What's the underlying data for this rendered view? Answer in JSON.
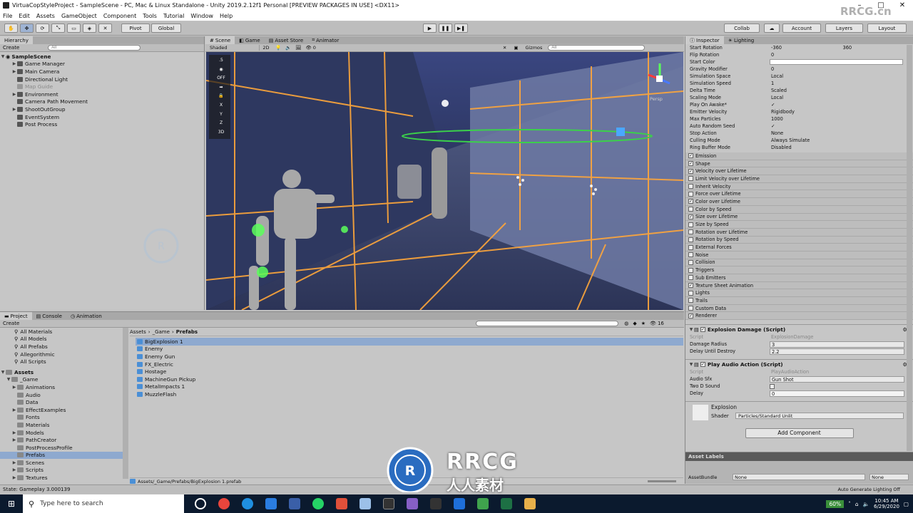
{
  "window": {
    "title": "VirtuaCopStyleProject - SampleScene - PC, Mac & Linux Standalone - Unity 2019.2.12f1 Personal [PREVIEW PACKAGES IN USE] <DX11>"
  },
  "menu": [
    "File",
    "Edit",
    "Assets",
    "GameObject",
    "Component",
    "Tools",
    "Tutorial",
    "Window",
    "Help"
  ],
  "toolbar": {
    "pivot": "Pivot",
    "global": "Global",
    "collab": "Collab",
    "account": "Account",
    "layers": "Layers",
    "layout": "Layout"
  },
  "hierarchy": {
    "tab": "Hierarchy",
    "create": "Create",
    "search_placeholder": "All",
    "scene": "SampleScene",
    "items": [
      "Game Manager",
      "Main Camera",
      "Directional Light",
      "Map Guide",
      "Environment",
      "Camera Path Movement",
      "ShootOutGroup",
      "EventSystem",
      "Post Process"
    ]
  },
  "scene": {
    "tabs": [
      "Scene",
      "Game",
      "Asset Store",
      "Animator"
    ],
    "shading": "Shaded",
    "mode2d": "2D",
    "gizmos": "Gizmos",
    "search_placeholder": "All",
    "persp": "Persp",
    "zero": "0",
    "gizmo_labels": [
      ".5",
      "OFF",
      "X",
      "Y",
      "Z",
      "3D"
    ]
  },
  "project": {
    "tabs": [
      "Project",
      "Console",
      "Animation"
    ],
    "create": "Create",
    "favorites": [
      "All Materials",
      "All Models",
      "All Prefabs",
      "Allegorithmic",
      "All Scripts"
    ],
    "assets_root": "Assets",
    "game_folder": "_Game",
    "folders": [
      "Animations",
      "Audio",
      "Data",
      "EffectExamples",
      "Fonts",
      "Materials",
      "Models",
      "PathCreator",
      "PostProcessProfile",
      "Prefabs",
      "Scenes",
      "Scripts",
      "Textures"
    ],
    "breadcrumb": [
      "Assets",
      "_Game",
      "Prefabs"
    ],
    "files": [
      "BigExplosion 1",
      "Enemy",
      "Enemy Gun",
      "FX_Electric",
      "Hostage",
      "MachineGun Pickup",
      "MetalImpacts 1",
      "MuzzleFlash"
    ],
    "path": "Assets/_Game/Prefabs/BigExplosion 1.prefab",
    "count": "16"
  },
  "inspector": {
    "tabs": [
      "Inspector",
      "Lighting"
    ],
    "props": [
      {
        "label": "Start Rotation",
        "value": "-360",
        "value2": "360"
      },
      {
        "label": "Flip Rotation",
        "value": "0"
      },
      {
        "label": "Start Color",
        "value": ""
      },
      {
        "label": "Gravity Modifier",
        "value": "0"
      },
      {
        "label": "Simulation Space",
        "value": "Local"
      },
      {
        "label": "Simulation Speed",
        "value": "1"
      },
      {
        "label": "Delta Time",
        "value": "Scaled"
      },
      {
        "label": "Scaling Mode",
        "value": "Local"
      },
      {
        "label": "Play On Awake*",
        "value": "✓"
      },
      {
        "label": "Emitter Velocity",
        "value": "Rigidbody"
      },
      {
        "label": "Max Particles",
        "value": "1000"
      },
      {
        "label": "Auto Random Seed",
        "value": "✓"
      },
      {
        "label": "Stop Action",
        "value": "None"
      },
      {
        "label": "Culling Mode",
        "value": "Always Simulate"
      },
      {
        "label": "Ring Buffer Mode",
        "value": "Disabled"
      }
    ],
    "modules": [
      {
        "name": "Emission",
        "on": true
      },
      {
        "name": "Shape",
        "on": true
      },
      {
        "name": "Velocity over Lifetime",
        "on": true
      },
      {
        "name": "Limit Velocity over Lifetime",
        "on": false
      },
      {
        "name": "Inherit Velocity",
        "on": false
      },
      {
        "name": "Force over Lifetime",
        "on": false
      },
      {
        "name": "Color over Lifetime",
        "on": true
      },
      {
        "name": "Color by Speed",
        "on": false
      },
      {
        "name": "Size over Lifetime",
        "on": true
      },
      {
        "name": "Size by Speed",
        "on": false
      },
      {
        "name": "Rotation over Lifetime",
        "on": false
      },
      {
        "name": "Rotation by Speed",
        "on": false
      },
      {
        "name": "External Forces",
        "on": false
      },
      {
        "name": "Noise",
        "on": false
      },
      {
        "name": "Collision",
        "on": false
      },
      {
        "name": "Triggers",
        "on": false
      },
      {
        "name": "Sub Emitters",
        "on": false
      },
      {
        "name": "Texture Sheet Animation",
        "on": true
      },
      {
        "name": "Lights",
        "on": false
      },
      {
        "name": "Trails",
        "on": false
      },
      {
        "name": "Custom Data",
        "on": false
      },
      {
        "name": "Renderer",
        "on": true
      }
    ],
    "explosion_damage": {
      "title": "Explosion Damage (Script)",
      "script_label": "Script",
      "script": "ExplosionDamage",
      "radius_label": "Damage Radius",
      "radius": "3",
      "delay_label": "Delay Until Destroy",
      "delay": "2.2"
    },
    "play_audio": {
      "title": "Play Audio Action (Script)",
      "script_label": "Script",
      "script": "PlayAudioAction",
      "sfx_label": "Audio Sfx",
      "sfx": "Gun Shot",
      "twod_label": "Two D Sound",
      "delay_label": "Delay",
      "delay": "0"
    },
    "material": {
      "name": "Explosion",
      "shader_label": "Shader",
      "shader": "Particles/Standard Unlit"
    },
    "add_component": "Add Component",
    "asset_labels": "Asset Labels",
    "assetbundle_label": "AssetBundle",
    "assetbundle": "None",
    "assetbundle_variant": "None"
  },
  "status": {
    "left": "State: Gameplay 3.000139",
    "right": "Auto Generate Lighting Off"
  },
  "taskbar": {
    "search_placeholder": "Type here to search",
    "battery": "60%",
    "time": "10:45 AM",
    "date": "6/29/2020"
  },
  "watermark": {
    "top_right": "RRCG.cn",
    "center": "RRCG",
    "center_sub": "人人素材"
  }
}
